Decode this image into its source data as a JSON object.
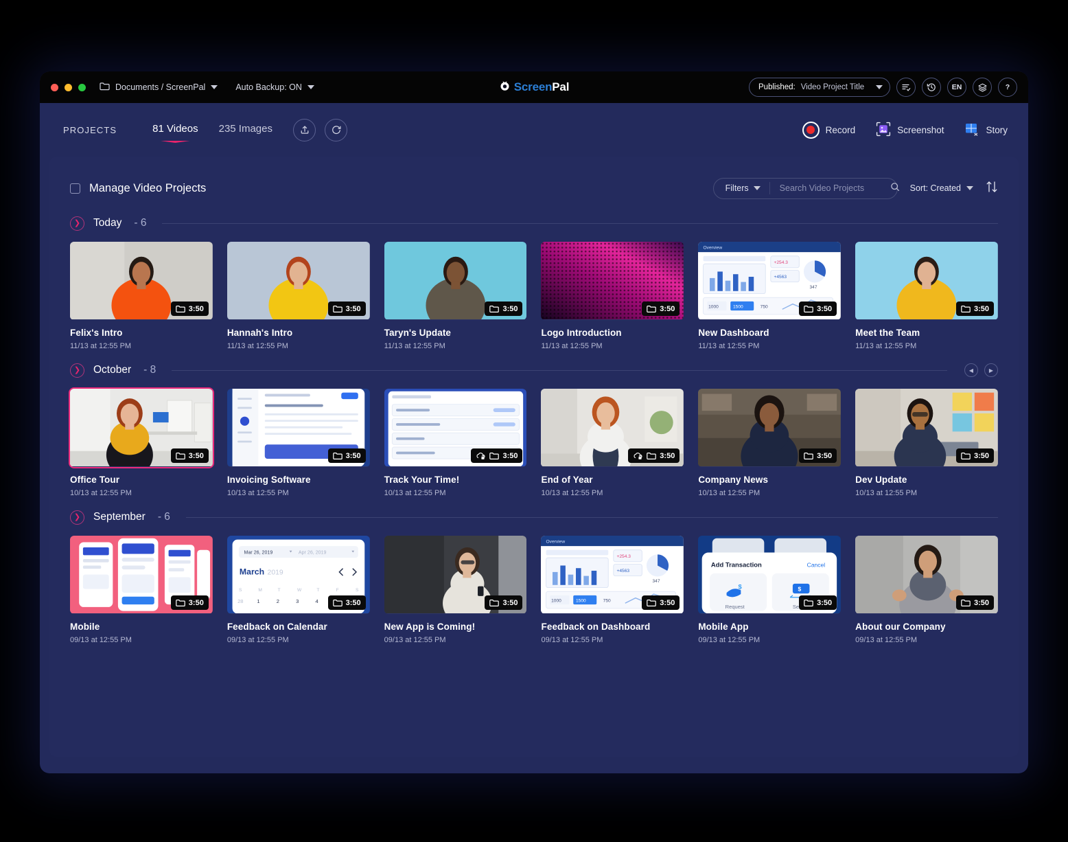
{
  "window": {
    "titlebar": {
      "folder_path": "Documents / ScreenPal",
      "auto_backup": "Auto Backup: ON",
      "logo_part1": "Screen",
      "logo_part2": "Pal",
      "publish_status_prefix": "Published:",
      "publish_project_title": "Video Project Title",
      "lang_button": "EN",
      "help_button": "?"
    }
  },
  "projects_bar": {
    "label": "PROJECTS",
    "tabs": [
      {
        "label": "81 Videos",
        "active": true
      },
      {
        "label": "235 Images",
        "active": false
      }
    ],
    "tools": [
      {
        "name": "upload-icon"
      },
      {
        "name": "restore-icon"
      }
    ],
    "actions": [
      {
        "label": "Record",
        "icon": "record-icon"
      },
      {
        "label": "Screenshot",
        "icon": "screenshot-icon"
      },
      {
        "label": "Story",
        "icon": "story-icon"
      }
    ]
  },
  "manage": {
    "title": "Manage Video Projects",
    "filters_label": "Filters",
    "search_placeholder": "Search Video Projects",
    "search_value": "",
    "sort_label": "Sort: Created"
  },
  "colors": {
    "accent_pink": "#e8246c",
    "selection_border": "#ec2a7b",
    "panel_bg": "#242b5e",
    "window_bg": "#232a5c",
    "titlebar_bg": "#050505",
    "logo_blue": "#2c7fd6"
  },
  "sections": [
    {
      "name": "Today",
      "count": "6",
      "has_navs": false,
      "cards": [
        {
          "title": "Felix's Intro",
          "date": "11/13 at 12:55 PM",
          "duration": "3:50",
          "badge_icon": "folder-icon",
          "selected": false,
          "art": "man-orange"
        },
        {
          "title": "Hannah's Intro",
          "date": "11/13 at 12:55 PM",
          "duration": "3:50",
          "badge_icon": "folder-icon",
          "selected": false,
          "art": "woman-yellow"
        },
        {
          "title": "Taryn's Update",
          "date": "11/13 at 12:55 PM",
          "duration": "3:50",
          "badge_icon": "folder-icon",
          "selected": false,
          "art": "woman-teal"
        },
        {
          "title": "Logo Introduction",
          "date": "11/13 at 12:55 PM",
          "duration": "3:50",
          "badge_icon": "folder-icon",
          "selected": false,
          "art": "magenta-dots"
        },
        {
          "title": "New Dashboard",
          "date": "11/13 at 12:55 PM",
          "duration": "3:50",
          "badge_icon": "folder-icon",
          "selected": false,
          "art": "dashboard"
        },
        {
          "title": "Meet the Team",
          "date": "11/13 at 12:55 PM",
          "duration": "3:50",
          "badge_icon": "folder-icon",
          "selected": false,
          "art": "woman-mustard"
        }
      ]
    },
    {
      "name": "October",
      "count": "8",
      "has_navs": true,
      "cards": [
        {
          "title": "Office Tour",
          "date": "10/13 at 12:55 PM",
          "duration": "3:50",
          "badge_icon": "folder-icon",
          "selected": true,
          "art": "office-woman"
        },
        {
          "title": "Invoicing Software",
          "date": "10/13 at 12:55 PM",
          "duration": "3:50",
          "badge_icon": "folder-icon",
          "selected": false,
          "art": "invoice-app"
        },
        {
          "title": "Track Your Time!",
          "date": "10/13 at 12:55 PM",
          "duration": "3:50",
          "badge_icon": "cloud-lock-folder-icon",
          "selected": false,
          "art": "table-app"
        },
        {
          "title": "End of Year",
          "date": "10/13 at 12:55 PM",
          "duration": "3:50",
          "badge_icon": "cloud-lock-folder-icon",
          "selected": false,
          "art": "redhead-desk"
        },
        {
          "title": "Company News",
          "date": "10/13 at 12:55 PM",
          "duration": "3:50",
          "badge_icon": "folder-icon",
          "selected": false,
          "art": "woman-kitchen"
        },
        {
          "title": "Dev Update",
          "date": "10/13 at 12:55 PM",
          "duration": "3:50",
          "badge_icon": "folder-icon",
          "selected": false,
          "art": "man-desk"
        }
      ]
    },
    {
      "name": "September",
      "count": "6",
      "has_navs": false,
      "cards": [
        {
          "title": "Mobile",
          "date": "09/13 at 12:55 PM",
          "duration": "3:50",
          "badge_icon": "folder-icon",
          "selected": false,
          "art": "phones-pink"
        },
        {
          "title": "Feedback on Calendar",
          "date": "09/13 at 12:55 PM",
          "duration": "3:50",
          "badge_icon": "folder-icon",
          "selected": false,
          "art": "calendar-app"
        },
        {
          "title": "New App is Coming!",
          "date": "09/13 at 12:55 PM",
          "duration": "3:50",
          "badge_icon": "folder-icon",
          "selected": false,
          "art": "woman-phone"
        },
        {
          "title": "Feedback on Dashboard",
          "date": "09/13 at 12:55 PM",
          "duration": "3:50",
          "badge_icon": "folder-icon",
          "selected": false,
          "art": "dashboard"
        },
        {
          "title": "Mobile App",
          "date": "09/13 at 12:55 PM",
          "duration": "3:50",
          "badge_icon": "folder-icon",
          "selected": false,
          "art": "transaction-app"
        },
        {
          "title": "About our Company",
          "date": "09/13 at 12:55 PM",
          "duration": "3:50",
          "badge_icon": "folder-icon",
          "selected": false,
          "art": "woman-gray"
        }
      ]
    }
  ],
  "thumb_art_text": {
    "calendar": {
      "range_from": "Mar 26, 2019",
      "range_to": "Apr 26, 2019",
      "month": "March",
      "year": "2019",
      "days": [
        "S",
        "M",
        "T",
        "W",
        "T",
        "F",
        "S"
      ],
      "numbers": [
        "28",
        "1",
        "2",
        "3",
        "4"
      ]
    },
    "transaction": {
      "title": "Add Transaction",
      "cancel": "Cancel",
      "request": "Request",
      "send": "Send"
    },
    "dashboard": {
      "label_overview": "Overview",
      "v1": "1000",
      "v2": "1500",
      "v3": "750",
      "v4": "+254.3",
      "v5": "+4563",
      "v6": "347"
    }
  }
}
